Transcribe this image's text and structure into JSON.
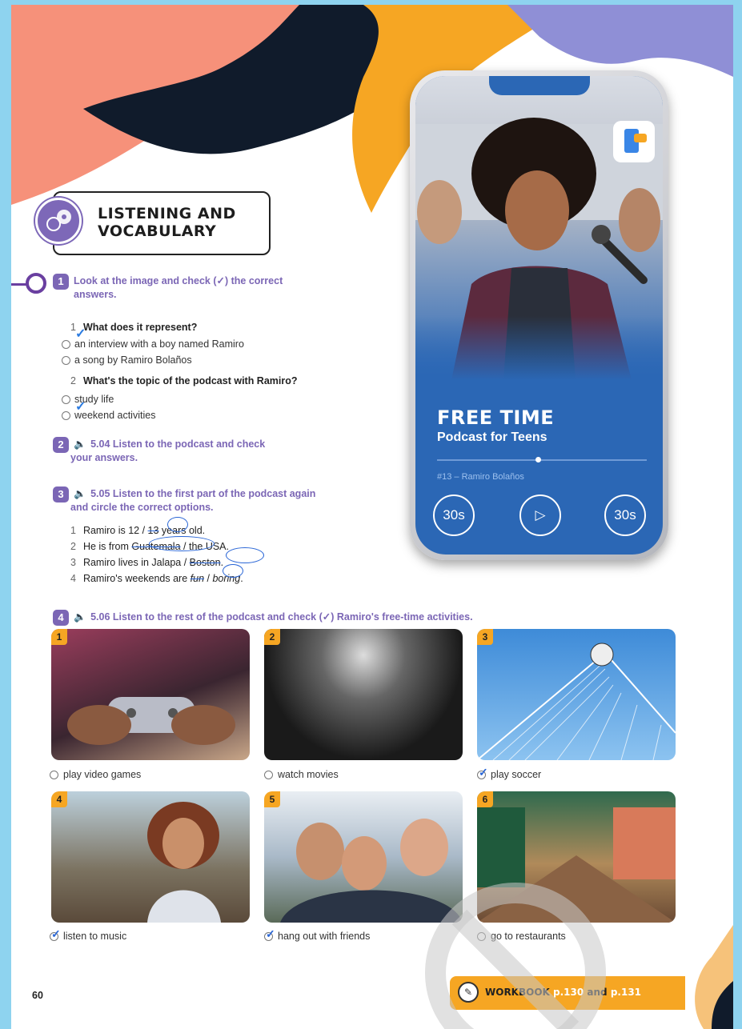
{
  "colors": {
    "accent": "#7b66b5",
    "orange": "#f6a623",
    "blue": "#2b67b5",
    "pink": "#f6917a",
    "navy": "#101b2b",
    "frame": "#8ed3ef"
  },
  "section": {
    "title_line1": "LISTENING AND",
    "title_line2": "VOCABULARY",
    "icon": "headphones-chat-icon"
  },
  "exercise1": {
    "number": "1",
    "instruction_line1": "Look at the image and check (✓) the correct",
    "instruction_line2": "answers.",
    "questions": [
      {
        "number": "1",
        "text": "What does it represent?",
        "options": [
          "an interview with a boy named Ramiro",
          "a song by Ramiro Bolaños"
        ]
      },
      {
        "number": "2",
        "text": "What's the topic of the podcast with Ramiro?",
        "options": [
          "study life",
          "weekend activities"
        ]
      }
    ]
  },
  "exercise2": {
    "number": "2",
    "track": "5.04",
    "instruction_line1": "Listen to the podcast and check",
    "instruction_line2": "your answers."
  },
  "exercise3": {
    "number": "3",
    "track": "5.05",
    "instruction_line1": "Listen to the first part of the podcast again",
    "instruction_line2": "and circle the correct options.",
    "items": [
      {
        "number": "1",
        "prefix": "Ramiro is ",
        "a": "12",
        "sep": " / ",
        "b": "13",
        "suffix": " years old."
      },
      {
        "number": "2",
        "prefix": "He is from ",
        "a": "Guatemala",
        "sep": " / ",
        "b": "the USA",
        "suffix": "."
      },
      {
        "number": "3",
        "prefix": "Ramiro lives in ",
        "a": "Jalapa",
        "sep": " / ",
        "b": "Boston",
        "suffix": "."
      },
      {
        "number": "4",
        "prefix": "Ramiro's weekends are ",
        "a": "fun",
        "sep": " / ",
        "b": "boring",
        "suffix": "."
      }
    ]
  },
  "phone": {
    "title": "FREE TIME",
    "subtitle": "Podcast for Teens",
    "episode": "#13 – Ramiro Bolaños",
    "rewind": "30s",
    "forward": "30s",
    "app_icon": "chat-phone-icon"
  },
  "exercise4": {
    "number": "4",
    "track": "5.06",
    "instruction": "Listen to the rest of the podcast and check (✓) Ramiro's free-time activities.",
    "activities": [
      {
        "number": "1",
        "label": "play video games",
        "checked": false
      },
      {
        "number": "2",
        "label": "watch movies",
        "checked": false
      },
      {
        "number": "3",
        "label": "play soccer",
        "checked": true
      },
      {
        "number": "4",
        "label": "listen to music",
        "checked": true
      },
      {
        "number": "5",
        "label": "hang out with friends",
        "checked": true
      },
      {
        "number": "6",
        "label": "go to restaurants",
        "checked": false
      }
    ]
  },
  "footer": {
    "page_number": "60",
    "workbook": "WORKBOOK",
    "workbook_p1": "p.130",
    "workbook_and": "and",
    "workbook_p2": "p.131"
  }
}
